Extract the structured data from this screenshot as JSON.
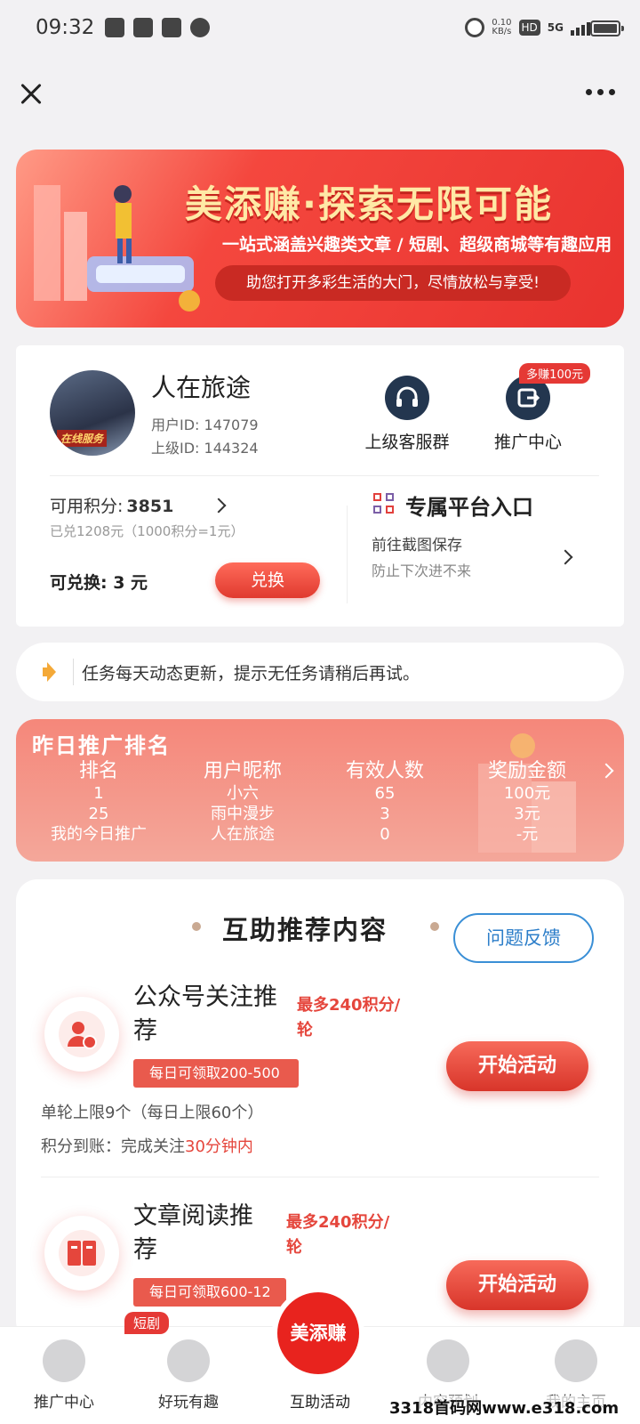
{
  "status_bar": {
    "time": "09:32",
    "net_speed": "0.10",
    "net_unit": "KB/s",
    "hd": "HD",
    "network": "5G",
    "icons": [
      "telegram-icon",
      "mail-icon",
      "app-icon",
      "message-icon",
      "speed-icon",
      "signal-icon",
      "battery-icon"
    ]
  },
  "nav": {
    "close_icon": "close-icon",
    "more_icon": "more-icon"
  },
  "banner": {
    "title": "美添赚·探索无限可能",
    "subtitle": "一站式涵盖兴趣类文章 / 短剧、超级商城等有趣应用",
    "tagline": "助您打开多彩生活的大门，尽情放松与享受!"
  },
  "user": {
    "avatar_tag": "在线服务",
    "name": "人在旅途",
    "user_id": "用户ID: 147079",
    "parent_id": "上级ID: 144324"
  },
  "quick_actions": [
    {
      "label": "上级客服群",
      "icon": "headset-icon"
    },
    {
      "label": "推广中心",
      "icon": "share-icon",
      "badge": "多赚100元"
    }
  ],
  "points": {
    "label": "可用积分:",
    "value": "3851",
    "note": "已兑1208元（1000积分=1元）",
    "exchangeable": "可兑换: 3 元",
    "exchange_button": "兑换"
  },
  "platform": {
    "title": "专属平台入口",
    "line1": "前往截图保存",
    "line2": "防止下次进不来"
  },
  "notice": {
    "text": "任务每天动态更新，提示无任务请稍后再试。"
  },
  "ranking": {
    "title": "昨日推广排名",
    "headers": [
      "排名",
      "用户昵称",
      "有效人数",
      "奖励金额"
    ],
    "rows": [
      [
        "1",
        "小六",
        "65",
        "100元"
      ],
      [
        "25",
        "雨中漫步",
        "3",
        "3元"
      ],
      [
        "我的今日推广",
        "人在旅途",
        "0",
        "-元"
      ]
    ]
  },
  "content": {
    "section_title": "互助推荐内容",
    "feedback_button": "问题反馈",
    "tasks": [
      {
        "title_line1": "公众号关注推",
        "title_line2": "荐",
        "max_line1": "最多240积分/",
        "max_line2": "轮",
        "daily": "每日可领取200-500",
        "button": "开始活动",
        "limit": "单轮上限9个（每日上限60个）",
        "arrival_prefix": "积分到账：完成关注",
        "arrival_highlight": "30分钟内",
        "icon": "user-star-icon"
      },
      {
        "title_line1": "文章阅读推",
        "title_line2": "荐",
        "max_line1": "最多240积分/",
        "max_line2": "轮",
        "daily": "每日可领取600-12",
        "button": "开始活动",
        "icon": "book-icon"
      }
    ]
  },
  "tabbar": {
    "tabs": [
      {
        "label": "推广中心",
        "icon": "grid-icon"
      },
      {
        "label": "好玩有趣",
        "icon": "planet-icon",
        "badge": "短剧"
      },
      {
        "label": "互助活动",
        "icon": "logo-icon"
      },
      {
        "label": "内容预划",
        "icon": "upload-doc-icon"
      },
      {
        "label": "我的主页",
        "icon": "user-icon"
      }
    ],
    "center_logo": "美添赚"
  },
  "watermark": "3318首码网www.e318.com"
}
